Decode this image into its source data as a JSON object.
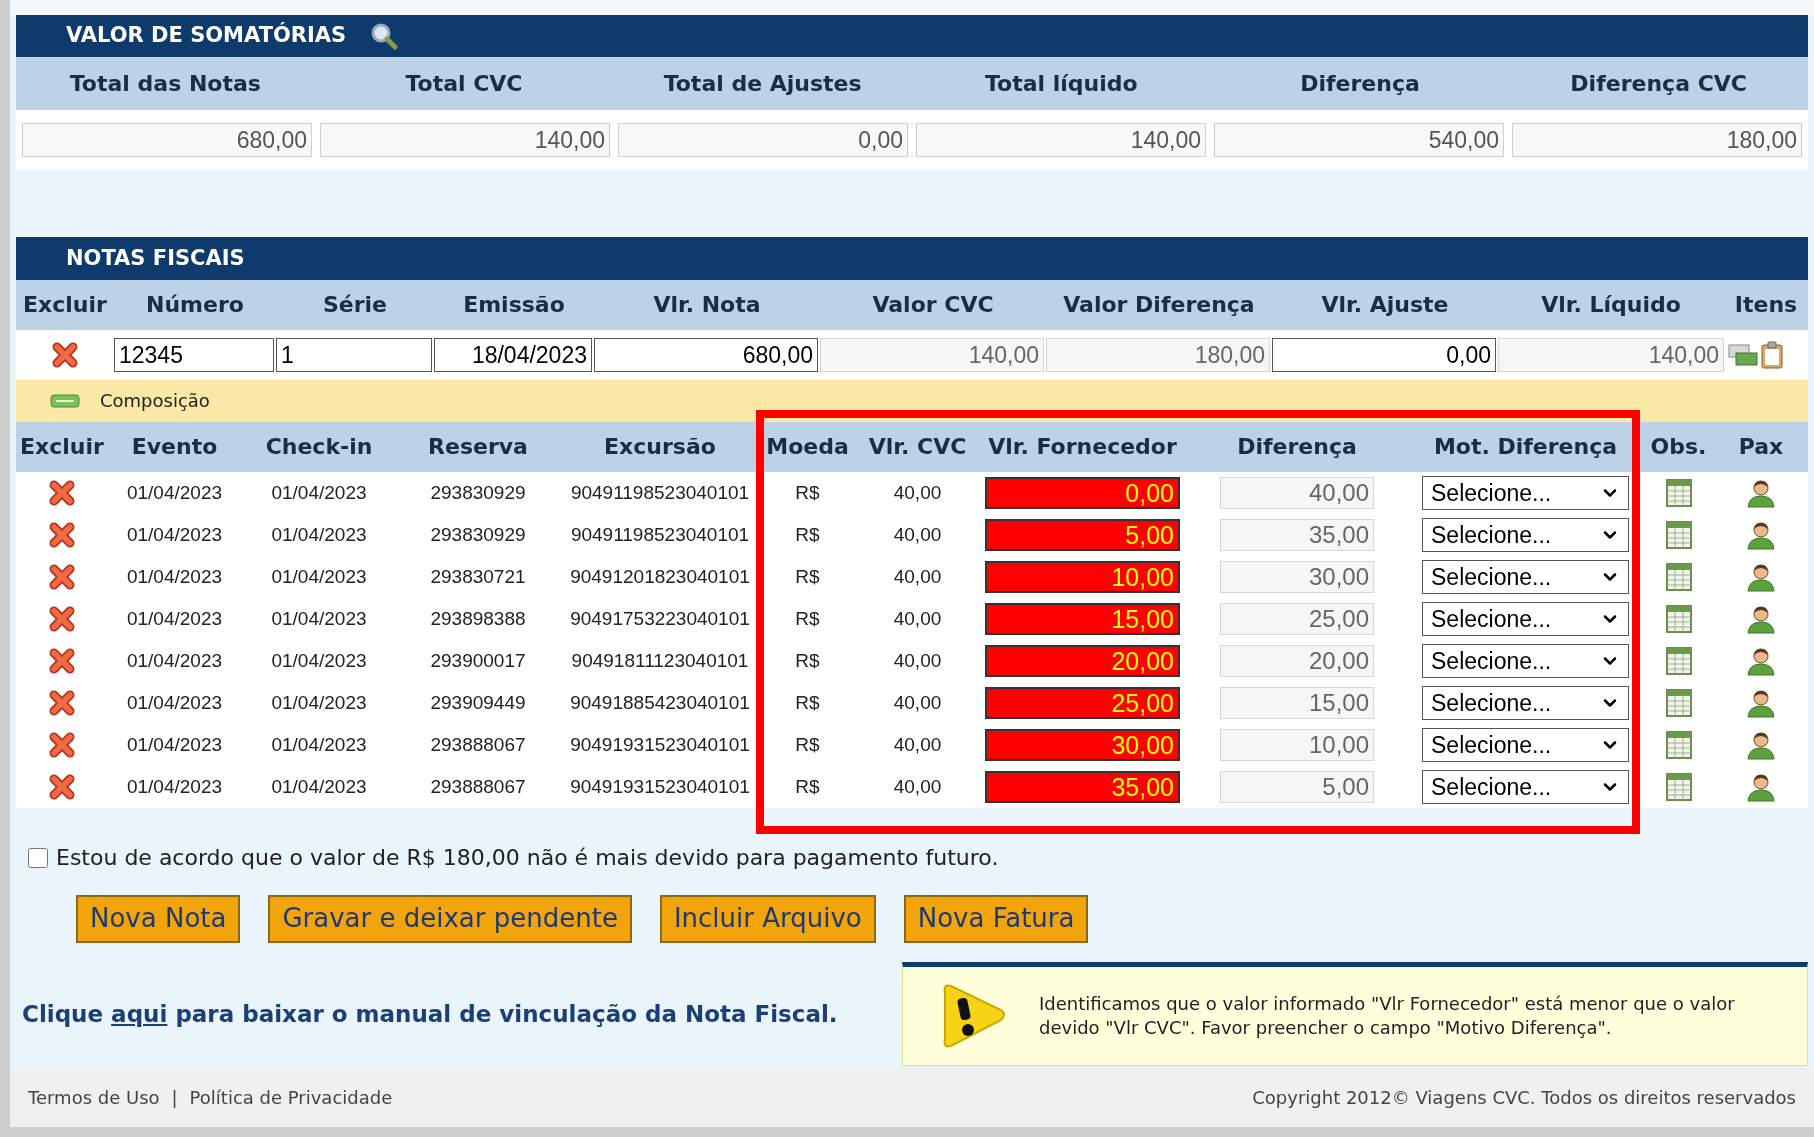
{
  "summary": {
    "title": "VALOR DE SOMATÓRIAS",
    "columns": [
      "Total das Notas",
      "Total CVC",
      "Total de Ajustes",
      "Total líquido",
      "Diferença",
      "Diferença CVC"
    ],
    "values": [
      "680,00",
      "140,00",
      "0,00",
      "140,00",
      "540,00",
      "180,00"
    ]
  },
  "notes": {
    "title": "NOTAS FISCAIS",
    "columns": [
      "Excluir",
      "Número",
      "Série",
      "Emissão",
      "Vlr. Nota",
      "Valor CVC",
      "Valor Diferença",
      "Vlr. Ajuste",
      "Vlr. Líquido",
      "Itens"
    ],
    "rows": [
      {
        "numero": "12345",
        "serie": "1",
        "emissao": "18/04/2023",
        "vlr_nota": "680,00",
        "valor_cvc": "140,00",
        "valor_diferenca": "180,00",
        "vlr_ajuste": "0,00",
        "vlr_liquido": "140,00"
      }
    ],
    "composition_label": "Composição"
  },
  "items": {
    "columns": [
      "Excluir",
      "Evento",
      "Check-in",
      "Reserva",
      "Excursão",
      "Moeda",
      "Vlr. CVC",
      "Vlr. Fornecedor",
      "Diferença",
      "Mot. Diferença",
      "Obs.",
      "Pax"
    ],
    "rows": [
      {
        "evento": "01/04/2023",
        "checkin": "01/04/2023",
        "reserva": "293830929",
        "excursao": "90491198523040101",
        "moeda": "R$",
        "vlr_cvc": "40,00",
        "vlr_fornecedor": "0,00",
        "flagged": true,
        "diferenca": "40,00",
        "motivo": "Selecione..."
      },
      {
        "evento": "01/04/2023",
        "checkin": "01/04/2023",
        "reserva": "293830929",
        "excursao": "90491198523040101",
        "moeda": "R$",
        "vlr_cvc": "40,00",
        "vlr_fornecedor": "5,00",
        "flagged": true,
        "diferenca": "35,00",
        "motivo": "Selecione..."
      },
      {
        "evento": "01/04/2023",
        "checkin": "01/04/2023",
        "reserva": "293830721",
        "excursao": "90491201823040101",
        "moeda": "R$",
        "vlr_cvc": "40,00",
        "vlr_fornecedor": "10,00",
        "flagged": true,
        "diferenca": "30,00",
        "motivo": "Selecione..."
      },
      {
        "evento": "01/04/2023",
        "checkin": "01/04/2023",
        "reserva": "293898388",
        "excursao": "90491753223040101",
        "moeda": "R$",
        "vlr_cvc": "40,00",
        "vlr_fornecedor": "15,00",
        "flagged": true,
        "diferenca": "25,00",
        "motivo": "Selecione..."
      },
      {
        "evento": "01/04/2023",
        "checkin": "01/04/2023",
        "reserva": "293900017",
        "excursao": "90491811123040101",
        "moeda": "R$",
        "vlr_cvc": "40,00",
        "vlr_fornecedor": "20,00",
        "flagged": true,
        "diferenca": "20,00",
        "motivo": "Selecione..."
      },
      {
        "evento": "01/04/2023",
        "checkin": "01/04/2023",
        "reserva": "293909449",
        "excursao": "90491885423040101",
        "moeda": "R$",
        "vlr_cvc": "40,00",
        "vlr_fornecedor": "25,00",
        "flagged": true,
        "diferenca": "15,00",
        "motivo": "Selecione..."
      },
      {
        "evento": "01/04/2023",
        "checkin": "01/04/2023",
        "reserva": "293888067",
        "excursao": "90491931523040101",
        "moeda": "R$",
        "vlr_cvc": "40,00",
        "vlr_fornecedor": "30,00",
        "flagged": true,
        "diferenca": "10,00",
        "motivo": "Selecione..."
      },
      {
        "evento": "01/04/2023",
        "checkin": "01/04/2023",
        "reserva": "293888067",
        "excursao": "90491931523040101",
        "moeda": "R$",
        "vlr_cvc": "40,00",
        "vlr_fornecedor": "35,00",
        "flagged": true,
        "diferenca": "5,00",
        "motivo": "Selecione..."
      }
    ]
  },
  "agreement": {
    "label": "Estou de acordo que o valor de R$ 180,00 não é mais devido para pagamento futuro.",
    "checked": false
  },
  "buttons": [
    "Nova Nota",
    "Gravar e deixar pendente",
    "Incluir Arquivo",
    "Nova Fatura"
  ],
  "manual_link": {
    "before": "Clique",
    "link": "aqui",
    "after": "para baixar o manual de vinculação da Nota Fiscal."
  },
  "alert": {
    "text": "Identificamos que o valor informado \"Vlr Fornecedor\" está menor que o valor devido \"Vlr CVC\". Favor preencher o campo \"Motivo Diferença\"."
  },
  "footer": {
    "links": [
      "Termos de Uso",
      "Política de Privacidade"
    ],
    "separator": "|",
    "copyright": "Copyright 2012© Viagens CVC. Todos os direitos reservados"
  }
}
